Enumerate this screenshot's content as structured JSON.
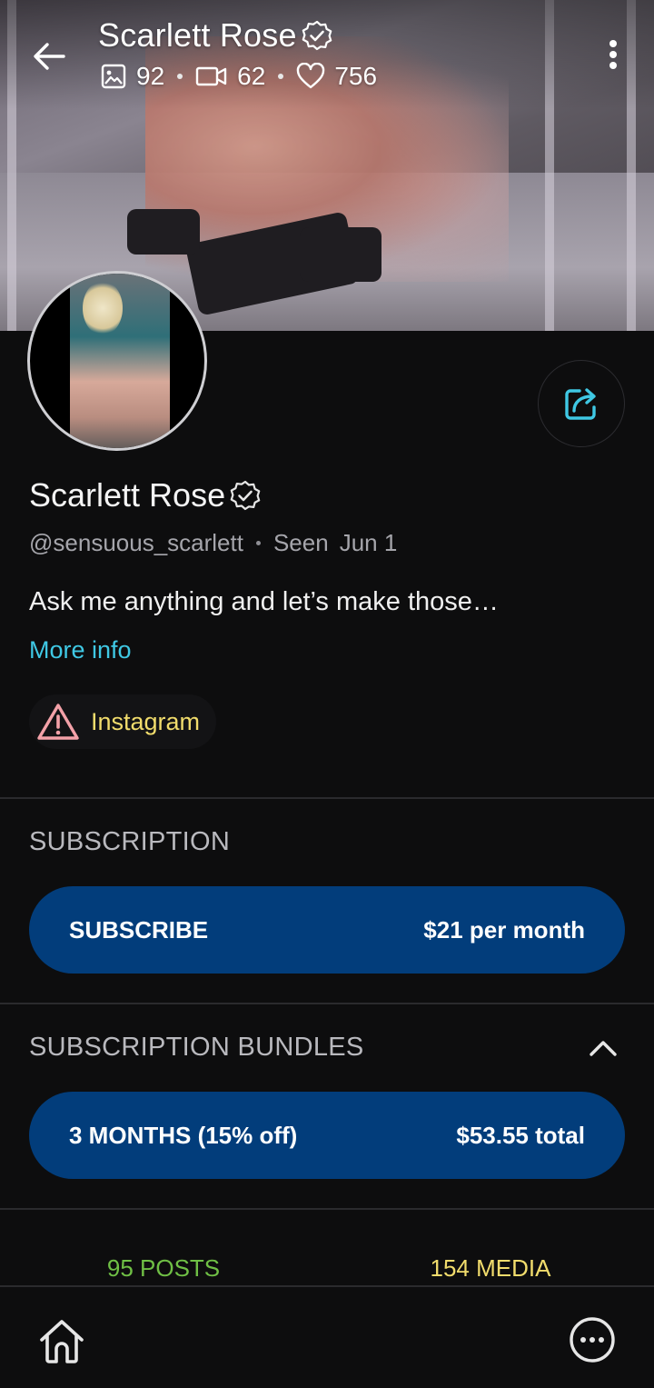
{
  "header": {
    "title": "Scarlett Rose",
    "stats": {
      "photos": "92",
      "videos": "62",
      "likes": "756"
    }
  },
  "profile": {
    "name": "Scarlett Rose",
    "handle": "@sensuous_scarlett",
    "seen_label": "Seen",
    "seen_date": "Jun 1",
    "bio": "Ask me anything and let’s make those…",
    "more_info": "More info",
    "social_link": "Instagram"
  },
  "subscription": {
    "title": "SUBSCRIPTION",
    "button_label": "SUBSCRIBE",
    "button_price": "$21 per month"
  },
  "bundles": {
    "title": "SUBSCRIPTION BUNDLES",
    "items": [
      {
        "label": "3 MONTHS (15% off)",
        "price": "$53.55 total"
      }
    ]
  },
  "tabs": {
    "posts": "95 POSTS",
    "media": "154 MEDIA"
  },
  "colors": {
    "background": "#0d0d0e",
    "primary_button": "#023d7b",
    "link": "#3fc8e4",
    "posts_tab": "#6fbf45",
    "media_tab": "#f1dc6c",
    "warning_icon": "#f3a1a8"
  },
  "icons": [
    "back-arrow-icon",
    "photo-icon",
    "video-icon",
    "heart-icon",
    "more-vertical-icon",
    "verified-icon",
    "share-icon",
    "warning-icon",
    "chevron-up-icon",
    "home-icon",
    "more-horizontal-icon"
  ]
}
